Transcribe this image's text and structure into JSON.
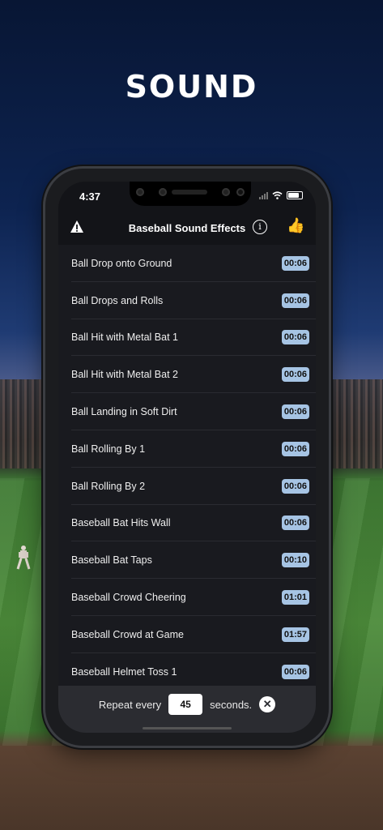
{
  "logo": {
    "text": "SOUND"
  },
  "status_bar": {
    "time": "4:37"
  },
  "navbar": {
    "title": "Baseball Sound Effects",
    "info_glyph": "i"
  },
  "sounds": [
    {
      "title": "Ball Drop onto Ground",
      "duration": "00:06"
    },
    {
      "title": "Ball Drops and Rolls",
      "duration": "00:06"
    },
    {
      "title": "Ball Hit with Metal Bat 1",
      "duration": "00:06"
    },
    {
      "title": "Ball Hit with Metal Bat 2",
      "duration": "00:06"
    },
    {
      "title": "Ball Landing in Soft Dirt",
      "duration": "00:06"
    },
    {
      "title": "Ball Rolling By 1",
      "duration": "00:06"
    },
    {
      "title": "Ball Rolling By 2",
      "duration": "00:06"
    },
    {
      "title": "Baseball Bat Hits Wall",
      "duration": "00:06"
    },
    {
      "title": "Baseball Bat Taps",
      "duration": "00:10"
    },
    {
      "title": "Baseball Crowd Cheering",
      "duration": "01:01"
    },
    {
      "title": "Baseball Crowd at Game",
      "duration": "01:57"
    },
    {
      "title": "Baseball Helmet Toss 1",
      "duration": "00:06"
    }
  ],
  "footer": {
    "repeat_label": "Repeat every",
    "repeat_value": "45",
    "unit_label": "seconds.",
    "close_glyph": "✕"
  },
  "colors": {
    "badge": "#a6c4e4",
    "accent_thumb": "#f2b23a"
  }
}
